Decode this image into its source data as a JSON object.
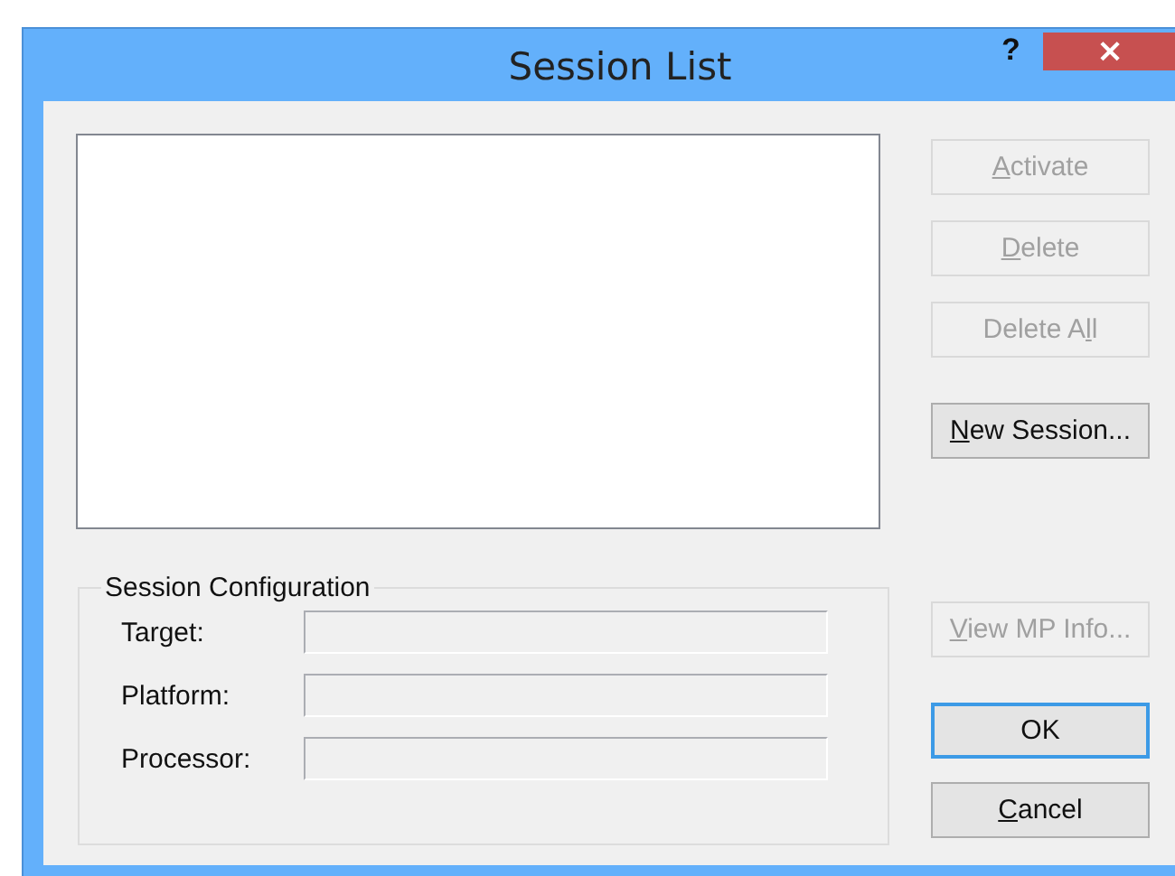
{
  "window": {
    "title": "Session List",
    "help": "?",
    "close": "×"
  },
  "action_buttons": [
    {
      "key": "A",
      "after": "ctivate",
      "disabled": true,
      "default": false
    },
    {
      "key": "D",
      "after": "elete",
      "disabled": true,
      "default": false
    },
    {
      "before": "Delete A",
      "key": "l",
      "after": "l",
      "disabled": true,
      "default": false
    },
    {
      "key": "N",
      "after": "ew Session...",
      "disabled": false,
      "default": false
    }
  ],
  "session_configuration": {
    "title": "Session Configuration",
    "fields": [
      {
        "label": "Target:",
        "disabled": true
      },
      {
        "label": "Platform:",
        "disabled": true
      },
      {
        "label": "Processor:",
        "disabled": true
      }
    ]
  },
  "dialog_buttons": [
    {
      "key": "V",
      "after": "iew MP Info...",
      "disabled": true,
      "default": false
    },
    {
      "after": "OK",
      "disabled": false,
      "default": true
    },
    {
      "key": "C",
      "after": "ancel",
      "disabled": false,
      "default": false
    }
  ]
}
